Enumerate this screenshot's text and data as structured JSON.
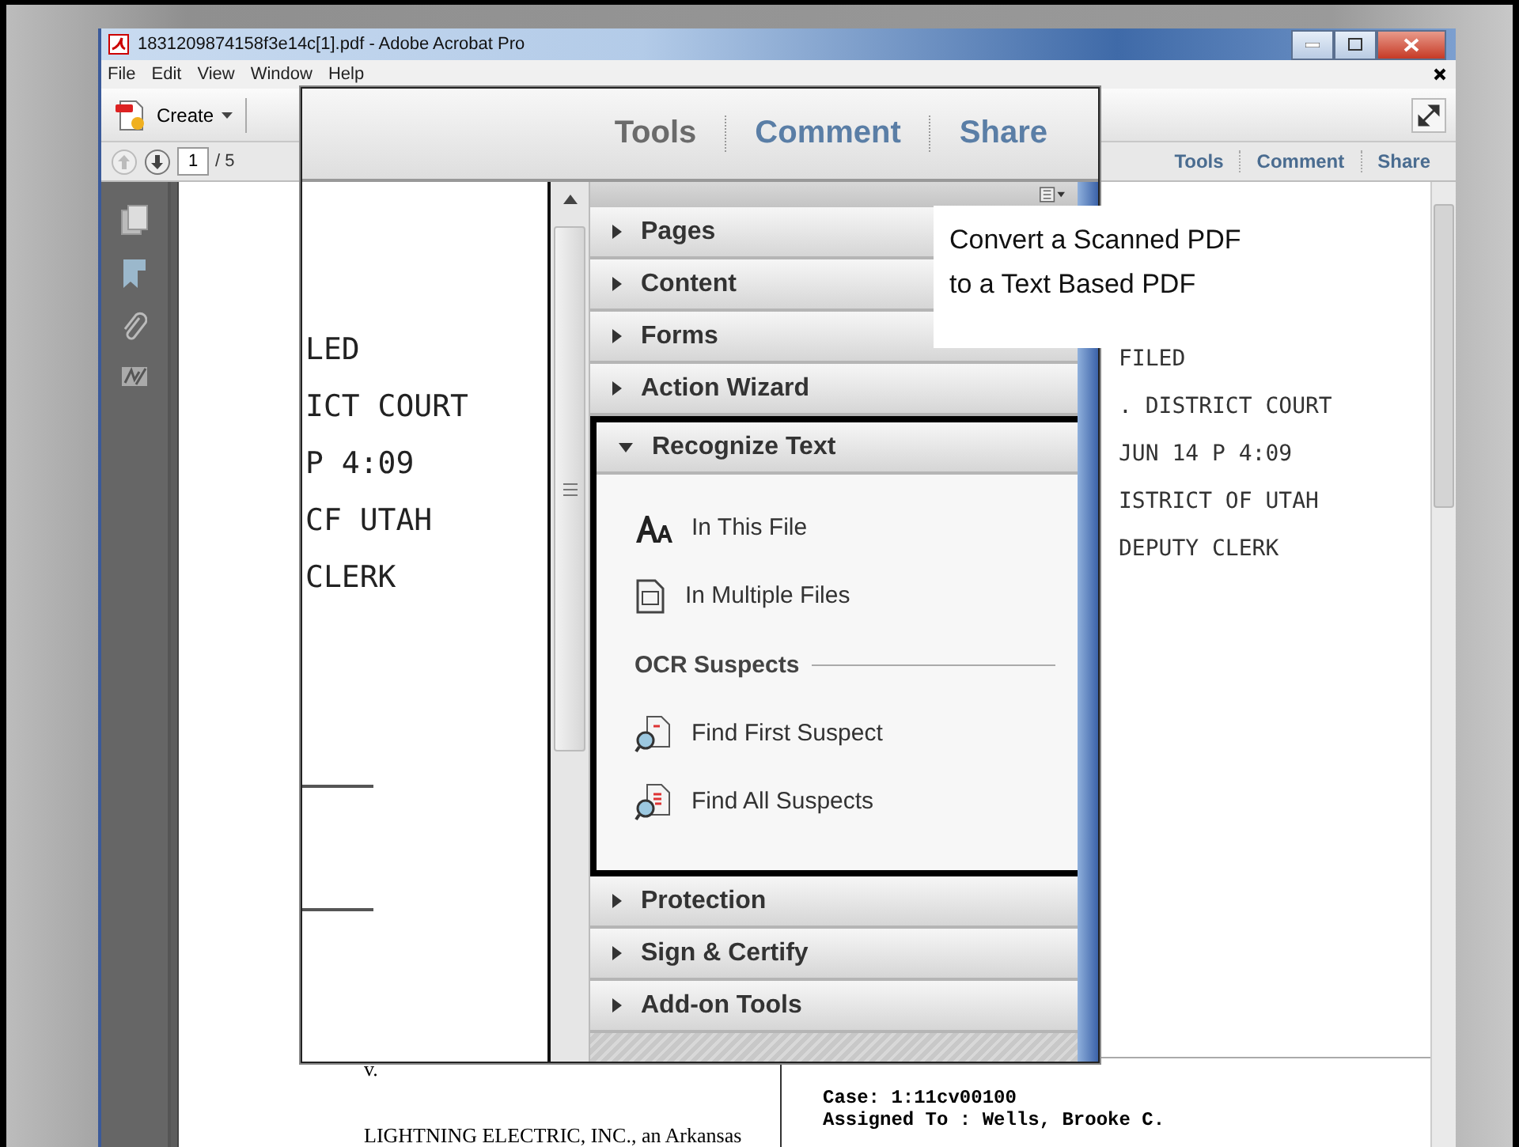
{
  "window": {
    "title": "1831209874158f3e14c[1].pdf - Adobe Acrobat Pro"
  },
  "menu": [
    "File",
    "Edit",
    "View",
    "Window",
    "Help"
  ],
  "toolbar": {
    "create": "Create"
  },
  "nav": {
    "page": "1",
    "total": "/ 5"
  },
  "pane_tabs": [
    {
      "label": "Tools"
    },
    {
      "label": "Comment"
    },
    {
      "label": "Share"
    }
  ],
  "document": {
    "stamp": [
      "FILED",
      ". DISTRICT COURT",
      "JUN 14  P 4:09",
      "ISTRICT OF UTAH",
      "DEPUTY CLERK"
    ],
    "caption": [
      "v.",
      "LIGHTNING ELECTRIC, INC., an Arkansas"
    ],
    "case_box": [
      "Case: 1:11cv00100",
      "Assigned To : Wells, Brooke C."
    ]
  },
  "magnified": {
    "tabs": [
      {
        "label": "Tools",
        "selected": true
      },
      {
        "label": "Comment",
        "selected": false
      },
      {
        "label": "Share",
        "selected": false
      }
    ],
    "stamp": [
      "LED",
      "ICT COURT",
      "P 4:09",
      "CF UTAH",
      "CLERK"
    ],
    "panels": [
      {
        "label": "Pages",
        "expanded": false,
        "highlighted": false
      },
      {
        "label": "Content",
        "expanded": false,
        "highlighted": false
      },
      {
        "label": "Forms",
        "expanded": false,
        "highlighted": false
      },
      {
        "label": "Action Wizard",
        "expanded": false,
        "highlighted": false
      },
      {
        "label": "Recognize Text",
        "expanded": true,
        "highlighted": true,
        "items": [
          {
            "kind": "tool",
            "label": "In This File"
          },
          {
            "kind": "tool",
            "label": "In Multiple Files"
          },
          {
            "kind": "heading",
            "label": "OCR Suspects"
          },
          {
            "kind": "tool",
            "label": "Find First Suspect"
          },
          {
            "kind": "tool",
            "label": "Find All Suspects"
          }
        ]
      },
      {
        "label": "Protection",
        "expanded": false,
        "highlighted": false
      },
      {
        "label": "Sign & Certify",
        "expanded": false,
        "highlighted": false
      },
      {
        "label": "Add-on Tools",
        "expanded": false,
        "highlighted": false
      }
    ]
  },
  "callout": {
    "text": "Convert a Scanned PDF to a Text Based PDF"
  }
}
